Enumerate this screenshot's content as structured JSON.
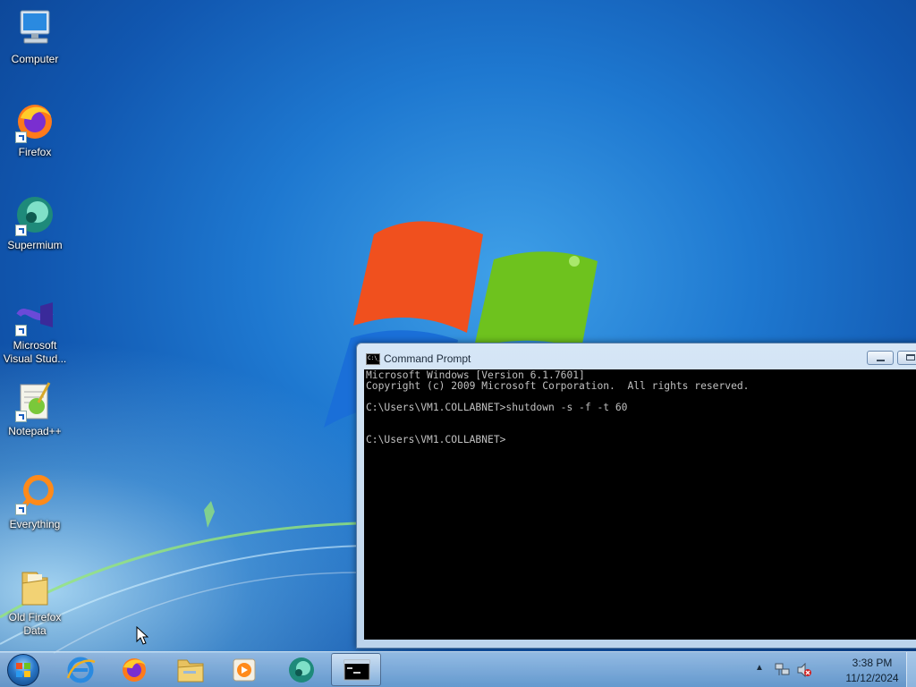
{
  "desktop_icons": [
    {
      "label": "Computer",
      "icon": "computer-icon",
      "shortcut": false
    },
    {
      "label": "Firefox",
      "icon": "firefox-icon",
      "shortcut": true
    },
    {
      "label": "Supermium",
      "icon": "supermium-icon",
      "shortcut": true
    },
    {
      "label": "Microsoft Visual Stud...",
      "icon": "visual-studio-icon",
      "shortcut": true
    },
    {
      "label": "Notepad++",
      "icon": "notepadpp-icon",
      "shortcut": true
    },
    {
      "label": "Everything",
      "icon": "everything-icon",
      "shortcut": true
    },
    {
      "label": "Old Firefox Data",
      "icon": "folder-icon",
      "shortcut": false
    }
  ],
  "cmd_window": {
    "title": "Command Prompt",
    "title_icon_text": "C:\\_",
    "console_text": "Microsoft Windows [Version 6.1.7601]\nCopyright (c) 2009 Microsoft Corporation.  All rights reserved.\n\nC:\\Users\\VM1.COLLABNET>shutdown -s -f -t 60\n\n\nC:\\Users\\VM1.COLLABNET>"
  },
  "taskbar": {
    "items": [
      {
        "name": "internet-explorer",
        "icon": "internet-explorer-icon",
        "active": false
      },
      {
        "name": "firefox",
        "icon": "firefox-icon",
        "active": false
      },
      {
        "name": "file-explorer",
        "icon": "folder-icon",
        "active": false
      },
      {
        "name": "media-player",
        "icon": "media-player-icon",
        "active": false
      },
      {
        "name": "supermium",
        "icon": "supermium-icon",
        "active": false
      },
      {
        "name": "command-prompt",
        "icon": "cmd-icon",
        "active": true
      }
    ],
    "tray": {
      "chevron": "▲",
      "time": "3:38 PM",
      "date": "11/12/2024",
      "icons": [
        "network-icon",
        "volume-muted-icon"
      ]
    }
  },
  "colors": {
    "desktop_blue": "#1e78d0",
    "logo_red": "#f0501e",
    "logo_green": "#6ec21e",
    "logo_blue": "#1a6fd8",
    "logo_yellow": "#ffc21a"
  }
}
